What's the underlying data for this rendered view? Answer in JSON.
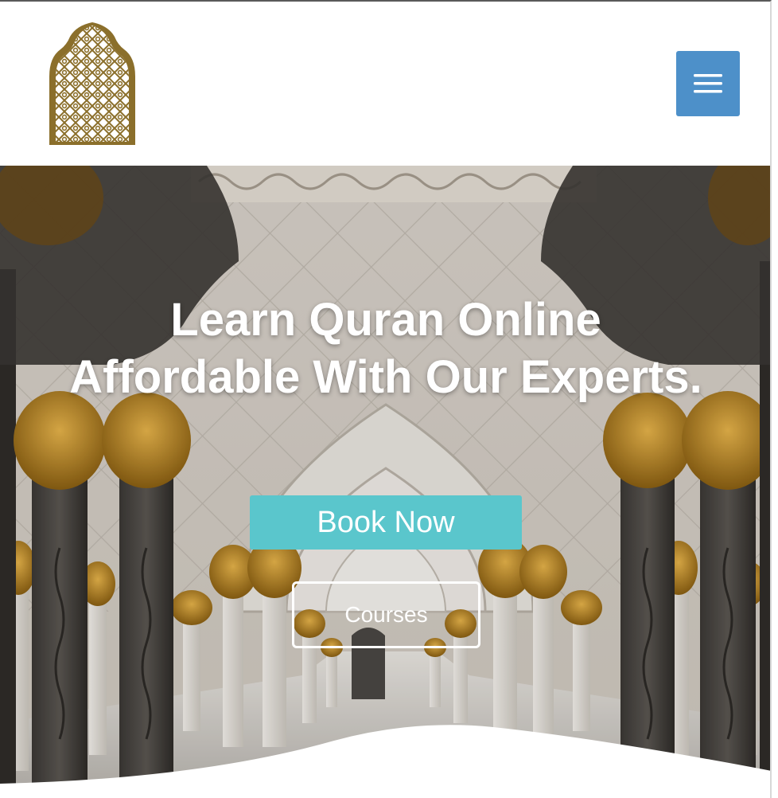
{
  "header": {
    "logo_icon": "arabesque-arch-logo-icon",
    "menu_icon": "hamburger-menu-icon",
    "brand_color": "#8b6f2b",
    "menu_color": "#4d90c9"
  },
  "hero": {
    "title_line1": "Learn Quran Online",
    "title_line2": "Affordable With Our Experts.",
    "book_button_label": "Book Now",
    "courses_button_label": "Courses",
    "book_button_color": "#5ac6cc"
  }
}
